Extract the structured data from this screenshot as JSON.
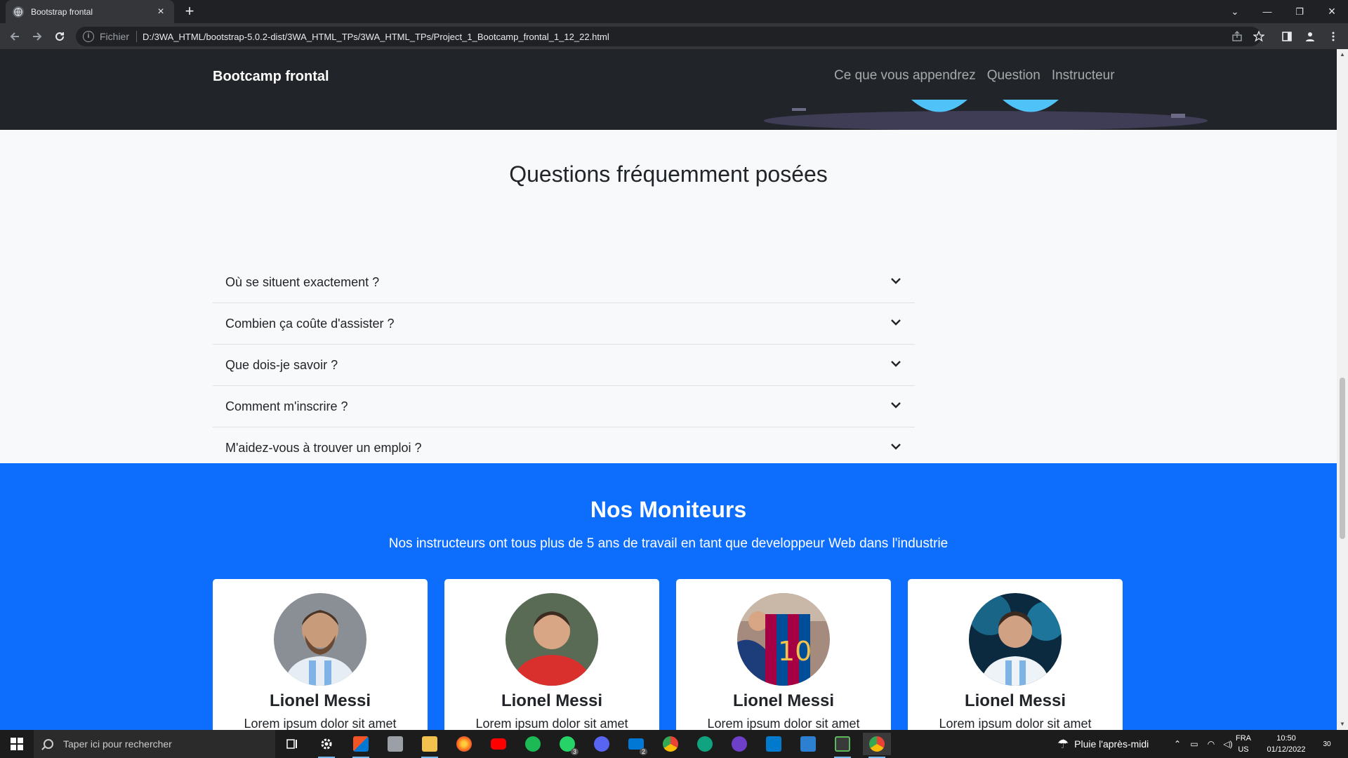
{
  "browser": {
    "tab_title": "Bootstrap frontal",
    "new_tab": "+",
    "scheme_label": "Fichier",
    "url": "D:/3WA_HTML/bootstrap-5.0.2-dist/3WA_HTML_TPs/3WA_HTML_TPs/Project_1_Bootcamp_frontal_1_12_22.html"
  },
  "navbar": {
    "brand": "Bootcamp frontal",
    "links": [
      "Ce que vous appendrez",
      "Question",
      "Instructeur"
    ]
  },
  "faq": {
    "title": "Questions fréquemment posées",
    "items": [
      "Où se situent exactement ?",
      "Combien ça coûte d'assister ?",
      "Que dois-je savoir ?",
      "Comment m'inscrire ?",
      "M'aidez-vous à trouver un emploi ?"
    ]
  },
  "instructors": {
    "title": "Nos Moniteurs",
    "subtitle": "Nos instructeurs ont tous plus de 5 ans de travail en tant que developpeur Web dans l'industrie",
    "cards": [
      {
        "name": "Lionel Messi",
        "text": "Lorem ipsum dolor sit amet"
      },
      {
        "name": "Lionel Messi",
        "text": "Lorem ipsum dolor sit amet"
      },
      {
        "name": "Lionel Messi",
        "text": "Lorem ipsum dolor sit amet"
      },
      {
        "name": "Lionel Messi",
        "text": "Lorem ipsum dolor sit amet"
      }
    ]
  },
  "taskbar": {
    "search_placeholder": "Taper ici pour rechercher",
    "weather": "Pluie l'après-midi",
    "lang_top": "FRA",
    "lang_bottom": "US",
    "time": "10:50",
    "date": "01/12/2022",
    "notifications": "30",
    "badges": {
      "whatsapp": "3",
      "mail": "2"
    }
  },
  "colors": {
    "navbar_bg": "#212529",
    "instructors_bg": "#0d6efd",
    "page_bg": "#f8f9fa"
  }
}
